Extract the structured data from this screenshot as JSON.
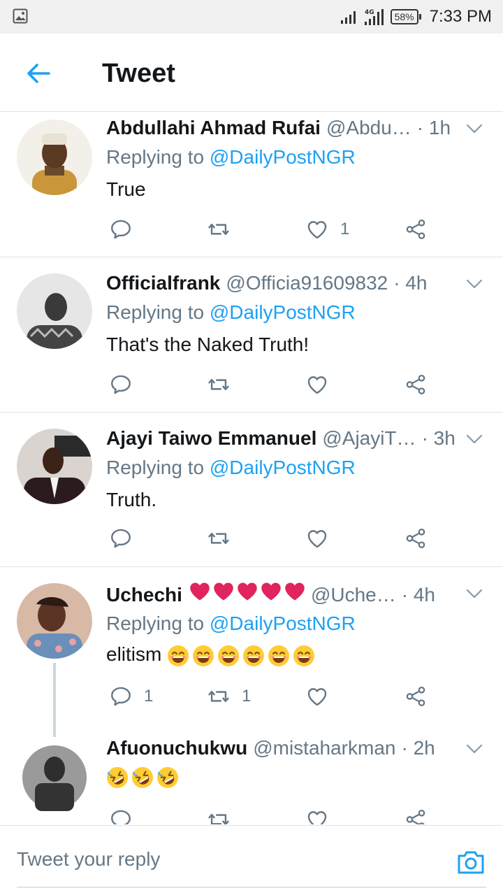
{
  "status_bar": {
    "network": "4G",
    "battery": "58%",
    "time": "7:33 PM"
  },
  "app_bar": {
    "title": "Tweet"
  },
  "tweets": [
    {
      "name": "Abdullahi Ahmad Rufai",
      "handle": "@Abdu…",
      "time": "· 1h",
      "replying_prefix": "Replying to",
      "replying_to": "@DailyPostNGR",
      "body": "True",
      "reply_count": "",
      "retweet_count": "",
      "like_count": "1"
    },
    {
      "name": "Officialfrank",
      "handle": "@Officia91609832",
      "time": "· 4h",
      "replying_prefix": "Replying to",
      "replying_to": "@DailyPostNGR",
      "body": "That's the Naked Truth!",
      "reply_count": "",
      "retweet_count": "",
      "like_count": ""
    },
    {
      "name": "Ajayi Taiwo Emmanuel",
      "handle": "@AjayiT…",
      "time": "· 3h",
      "replying_prefix": "Replying to",
      "replying_to": "@DailyPostNGR",
      "body": "Truth.",
      "reply_count": "",
      "retweet_count": "",
      "like_count": ""
    },
    {
      "name": "Uchechi",
      "handle": "@Uche…",
      "time": "· 4h",
      "replying_prefix": "Replying to",
      "replying_to": "@DailyPostNGR",
      "body": "elitism",
      "reply_count": "1",
      "retweet_count": "1",
      "like_count": ""
    },
    {
      "name": "Afuonuchukwu",
      "handle": "@mistaharkman",
      "time": "· 2h",
      "reply_count": "",
      "retweet_count": "",
      "like_count": ""
    }
  ],
  "reply_bar": {
    "placeholder": "Tweet your reply"
  },
  "colors": {
    "accent": "#1da1f2",
    "secondary_text": "#657786",
    "divider": "#dfe3e6",
    "heart_emoji": "#e0245e"
  }
}
